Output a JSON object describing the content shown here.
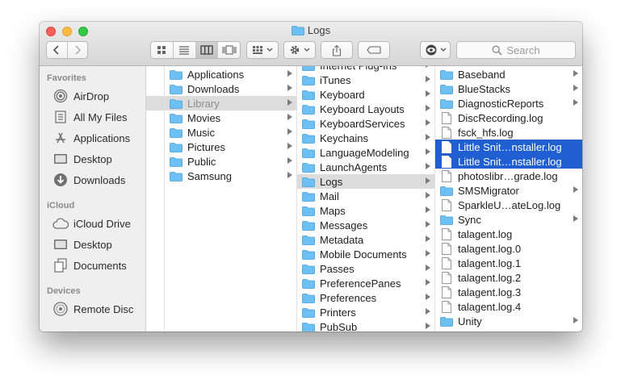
{
  "window": {
    "title": "Logs"
  },
  "toolbar": {
    "search_placeholder": "Search"
  },
  "sidebar": {
    "sections": [
      {
        "title": "Favorites",
        "items": [
          {
            "label": "AirDrop",
            "icon": "airdrop-icon"
          },
          {
            "label": "All My Files",
            "icon": "all-files-icon"
          },
          {
            "label": "Applications",
            "icon": "applications-icon"
          },
          {
            "label": "Desktop",
            "icon": "desktop-icon"
          },
          {
            "label": "Downloads",
            "icon": "downloads-icon"
          }
        ]
      },
      {
        "title": "iCloud",
        "items": [
          {
            "label": "iCloud Drive",
            "icon": "cloud-icon"
          },
          {
            "label": "Desktop",
            "icon": "desktop-icon"
          },
          {
            "label": "Documents",
            "icon": "documents-icon"
          }
        ]
      },
      {
        "title": "Devices",
        "items": [
          {
            "label": "Remote Disc",
            "icon": "disc-icon"
          }
        ]
      }
    ]
  },
  "columns": {
    "home": [
      {
        "label": "Applications",
        "type": "folder"
      },
      {
        "label": "Downloads",
        "type": "folder"
      },
      {
        "label": "Library",
        "type": "folder",
        "state": "path"
      },
      {
        "label": "Movies",
        "type": "folder"
      },
      {
        "label": "Music",
        "type": "folder"
      },
      {
        "label": "Pictures",
        "type": "folder"
      },
      {
        "label": "Public",
        "type": "folder"
      },
      {
        "label": "Samsung",
        "type": "folder"
      }
    ],
    "library": [
      {
        "label": "Internet Plug-Ins",
        "type": "folder"
      },
      {
        "label": "iTunes",
        "type": "folder"
      },
      {
        "label": "Keyboard",
        "type": "folder"
      },
      {
        "label": "Keyboard Layouts",
        "type": "folder"
      },
      {
        "label": "KeyboardServices",
        "type": "folder"
      },
      {
        "label": "Keychains",
        "type": "folder"
      },
      {
        "label": "LanguageModeling",
        "type": "folder"
      },
      {
        "label": "LaunchAgents",
        "type": "folder"
      },
      {
        "label": "Logs",
        "type": "folder",
        "state": "path"
      },
      {
        "label": "Mail",
        "type": "folder"
      },
      {
        "label": "Maps",
        "type": "folder"
      },
      {
        "label": "Messages",
        "type": "folder"
      },
      {
        "label": "Metadata",
        "type": "folder"
      },
      {
        "label": "Mobile Documents",
        "type": "folder"
      },
      {
        "label": "Passes",
        "type": "folder"
      },
      {
        "label": "PreferencePanes",
        "type": "folder"
      },
      {
        "label": "Preferences",
        "type": "folder"
      },
      {
        "label": "Printers",
        "type": "folder"
      },
      {
        "label": "PubSub",
        "type": "folder"
      }
    ],
    "logs": [
      {
        "label": "Baseband",
        "type": "folder"
      },
      {
        "label": "BlueStacks",
        "type": "folder"
      },
      {
        "label": "DiagnosticReports",
        "type": "folder"
      },
      {
        "label": "DiscRecording.log",
        "type": "file"
      },
      {
        "label": "fsck_hfs.log",
        "type": "file"
      },
      {
        "label": "Little Snit…nstaller.log",
        "type": "file",
        "state": "selected"
      },
      {
        "label": "Little Snit…nstaller.log",
        "type": "file",
        "state": "selected"
      },
      {
        "label": "photoslibr…grade.log",
        "type": "file"
      },
      {
        "label": "SMSMigrator",
        "type": "folder"
      },
      {
        "label": "SparkleU…ateLog.log",
        "type": "file"
      },
      {
        "label": "Sync",
        "type": "folder"
      },
      {
        "label": "talagent.log",
        "type": "file"
      },
      {
        "label": "talagent.log.0",
        "type": "file"
      },
      {
        "label": "talagent.log.1",
        "type": "file"
      },
      {
        "label": "talagent.log.2",
        "type": "file"
      },
      {
        "label": "talagent.log.3",
        "type": "file"
      },
      {
        "label": "talagent.log.4",
        "type": "file"
      },
      {
        "label": "Unity",
        "type": "folder"
      }
    ]
  },
  "colors": {
    "selection": "#1f5fd1",
    "folder": "#6cc0f4",
    "path_highlight": "#dcdcdc"
  }
}
